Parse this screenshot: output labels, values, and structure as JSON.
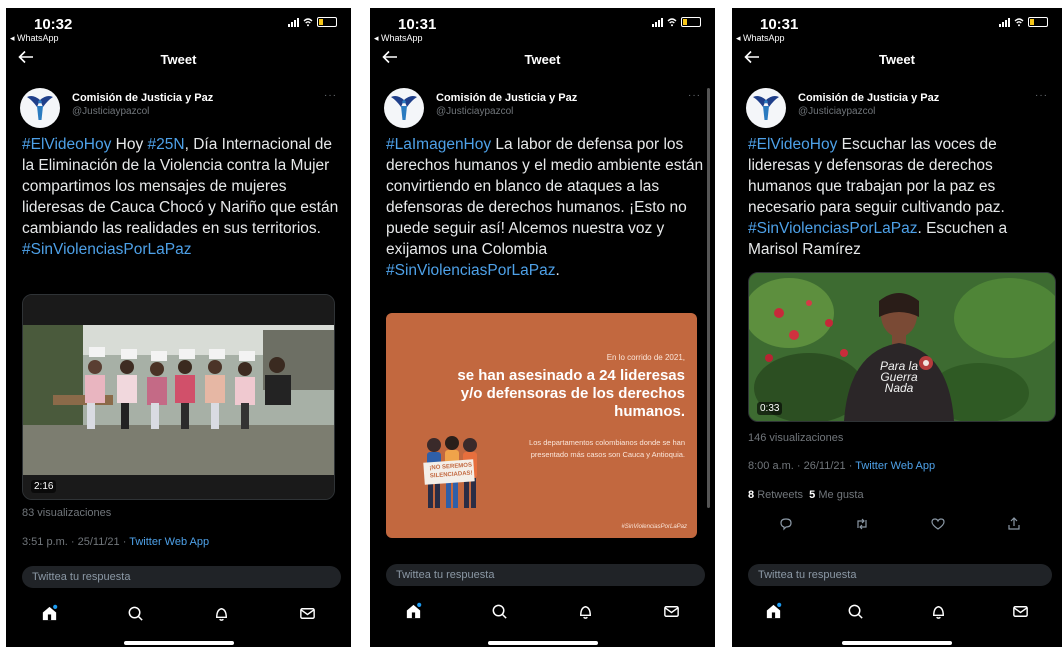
{
  "screens": [
    {
      "time": "10:32",
      "back_app": "◂ WhatsApp",
      "header_title": "Tweet",
      "author_name": "Comisión de Justicia y Paz",
      "author_handle": "@Justiciaypazcol",
      "more": "···",
      "tweet_segments": [
        {
          "text": "#ElVideoHoy",
          "link": true
        },
        {
          "text": " Hoy ",
          "link": false
        },
        {
          "text": "#25N",
          "link": true
        },
        {
          "text": ", Día Internacional de la Eliminación de la Violencia contra la Mujer compartimos los mensajes de mujeres lideresas de Cauca Chocó y Nariño que están cambiando las realidades en sus territorios. ",
          "link": false
        },
        {
          "text": "#SinViolenciasPorLaPaz",
          "link": true
        }
      ],
      "media_duration": "2:16",
      "views": "83 visualizaciones",
      "timestamp": "3:51 p.m. · 25/11/21 · ",
      "source": "Twitter Web App",
      "reply_placeholder": "Twittea tu respuesta"
    },
    {
      "time": "10:31",
      "back_app": "◂ WhatsApp",
      "header_title": "Tweet",
      "author_name": "Comisión de Justicia y Paz",
      "author_handle": "@Justiciaypazcol",
      "more": "···",
      "tweet_segments": [
        {
          "text": "#LaImagenHoy",
          "link": true
        },
        {
          "text": " La labor de defensa por los derechos humanos y el medio ambiente están convirtiendo en blanco de ataques a las defensoras de derechos humanos. ¡Esto no puede seguir así! Alcemos nuestra voz y exijamos una Colombia ",
          "link": false
        },
        {
          "text": "#SinViolenciasPorLaPaz",
          "link": true
        },
        {
          "text": ".",
          "link": false
        }
      ],
      "poster": {
        "line1": "En lo corrido de 2021,",
        "headline": "se han asesinado a 24 lideresas y/o defensoras de los derechos humanos.",
        "body": "Los departamentos colombianos donde se han presentado más casos son Cauca y Antioquia.",
        "sign": "¡NO SEREMOS SILENCIADAS!",
        "hashtag": "#SinViolenciasPorLaPaz",
        "bg_color": "#c2683f"
      },
      "reply_placeholder": "Twittea tu respuesta"
    },
    {
      "time": "10:31",
      "back_app": "◂ WhatsApp",
      "header_title": "Tweet",
      "author_name": "Comisión de Justicia y Paz",
      "author_handle": "@Justiciaypazcol",
      "more": "···",
      "tweet_segments": [
        {
          "text": "#ElVideoHoy",
          "link": true
        },
        {
          "text": " Escuchar las voces de lideresas y defensoras de derechos humanos que trabajan por la paz es necesario para seguir cultivando paz. ",
          "link": false
        },
        {
          "text": "#SinViolenciasPorLaPaz",
          "link": true
        },
        {
          "text": ". Escuchen a Marisol Ramírez",
          "link": false
        }
      ],
      "shirt_text": "Para la Guerra Nada",
      "media_duration": "0:33",
      "views": "146 visualizaciones",
      "timestamp": "8:00 a.m. · 26/11/21 · ",
      "source": "Twitter Web App",
      "retweets": "8",
      "retweets_label": "Retweets",
      "likes": "5",
      "likes_label": "Me gusta",
      "reply_placeholder": "Twittea tu respuesta"
    }
  ],
  "colors": {
    "background": "#000000",
    "link": "#4ea1e8",
    "muted": "#71767b",
    "text": "#e7e9ea"
  },
  "icons": [
    "home-icon",
    "search-icon",
    "notifications-icon",
    "messages-icon",
    "reply-icon",
    "retweet-icon",
    "like-icon",
    "share-icon",
    "back-arrow-icon"
  ]
}
